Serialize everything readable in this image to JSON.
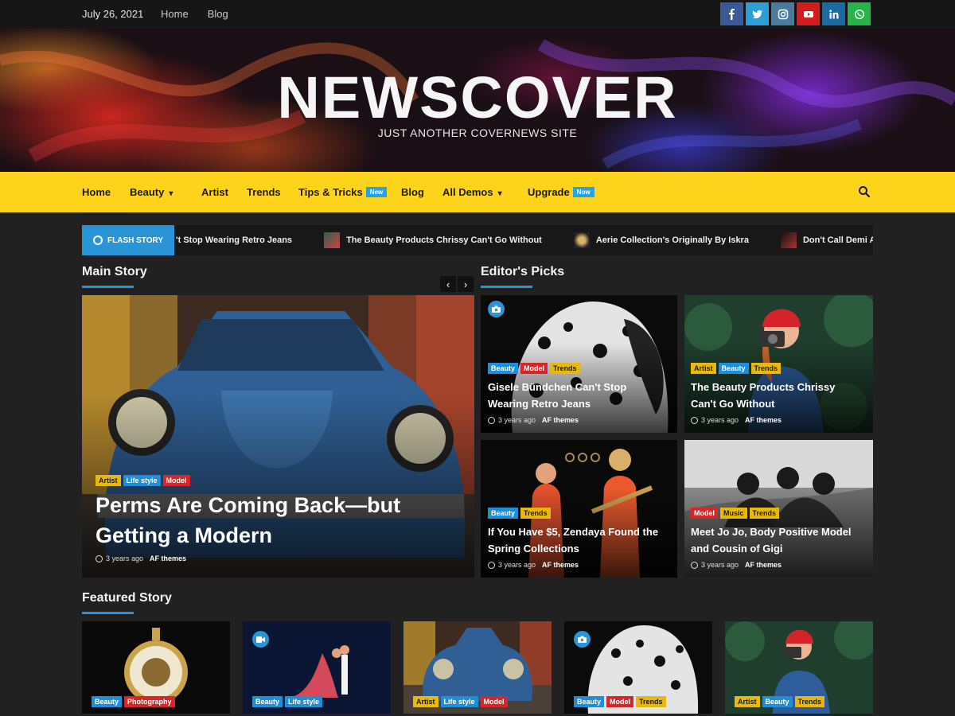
{
  "topbar": {
    "date": "July 26, 2021",
    "links": [
      "Home",
      "Blog"
    ],
    "social": [
      {
        "name": "facebook-icon",
        "color": "#3b5998"
      },
      {
        "name": "twitter-icon",
        "color": "#2d9fd8"
      },
      {
        "name": "instagram-icon",
        "color": "#4a7b9d"
      },
      {
        "name": "youtube-icon",
        "color": "#d51c1c"
      },
      {
        "name": "linkedin-icon",
        "color": "#1b6aa0"
      },
      {
        "name": "whatsapp-icon",
        "color": "#26b34a"
      }
    ]
  },
  "header": {
    "title": "NEWSCOVER",
    "tagline": "JUST ANOTHER COVERNEWS SITE"
  },
  "nav": {
    "items": [
      {
        "label": "Home"
      },
      {
        "label": "Beauty",
        "dropdown": true
      },
      {
        "label": "Artist"
      },
      {
        "label": "Trends"
      },
      {
        "label": "Tips & Tricks",
        "badge": "New"
      },
      {
        "label": "Blog"
      },
      {
        "label": "All Demos",
        "dropdown": true
      },
      {
        "label": "Upgrade",
        "badge": "Now"
      }
    ],
    "search_icon": "search-icon"
  },
  "flash": {
    "label": "FLASH STORY",
    "items": [
      "Gisele Bündchen Can't Stop Wearing Retro Jeans",
      "The Beauty Products Chrissy Can't Go Without",
      "Aerie Collection's Originally By Iskra",
      "Don't Call Demi A “Babe”"
    ],
    "first_visible": "'t Stop Wearing Retro Jeans"
  },
  "main_story": {
    "heading": "Main Story",
    "prev": "‹",
    "next": "›",
    "tags": [
      "Artist",
      "Life style",
      "Model"
    ],
    "title_line1": "Perms Are Coming Back—but",
    "title_line2": "Getting a Modern",
    "time": "3 years ago",
    "author": "AF themes"
  },
  "editors_picks": {
    "heading": "Editor's Picks",
    "cards": [
      {
        "tags": [
          "Beauty",
          "Model",
          "Trends"
        ],
        "title": "Gisele Bündchen Can't Stop Wearing Retro Jeans",
        "time": "3 years ago",
        "author": "AF themes"
      },
      {
        "tags": [
          "Artist",
          "Beauty",
          "Trends"
        ],
        "title": "The Beauty Products Chrissy Can't Go Without",
        "time": "3 years ago",
        "author": "AF themes"
      },
      {
        "tags": [
          "Beauty",
          "Trends"
        ],
        "title": "If You Have $5, Zendaya Found the Spring Collections",
        "time": "3 years ago",
        "author": "AF themes"
      },
      {
        "tags": [
          "Model",
          "Music",
          "Trends"
        ],
        "title": "Meet Jo Jo, Body Positive Model and Cousin of Gigi",
        "time": "3 years ago",
        "author": "AF themes"
      }
    ]
  },
  "featured": {
    "heading": "Featured Story",
    "cards": [
      {
        "tags": [
          "Beauty",
          "Photography"
        ]
      },
      {
        "tags": [
          "Beauty",
          "Life style"
        ]
      },
      {
        "tags": [
          "Artist",
          "Life style",
          "Model"
        ]
      },
      {
        "tags": [
          "Beauty",
          "Model",
          "Trends"
        ]
      },
      {
        "tags": [
          "Artist",
          "Beauty",
          "Trends"
        ]
      }
    ]
  },
  "colors": {
    "accent": "#2a95d6",
    "nav_bg": "#fdd31b",
    "page_bg": "#212121"
  }
}
